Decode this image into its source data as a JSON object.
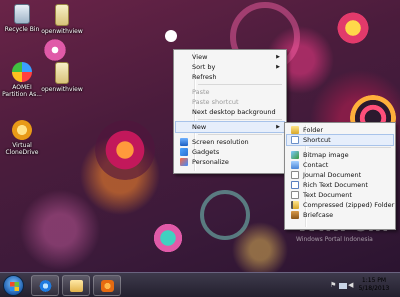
{
  "desktop": {
    "icons": [
      {
        "label": "Recycle Bin",
        "icon": "recycle-bin-icon"
      },
      {
        "label": "openwithview",
        "icon": "folder-icon"
      },
      {
        "label": "AOMEI Partition As...",
        "icon": "aomei-icon"
      },
      {
        "label": "openwithview",
        "icon": "folder-icon"
      },
      {
        "label": "Virtual CloneDrive",
        "icon": "clonedrive-icon"
      }
    ]
  },
  "context_menu": {
    "items": [
      {
        "label": "View",
        "submenu": true
      },
      {
        "label": "Sort by",
        "submenu": true
      },
      {
        "label": "Refresh"
      },
      {
        "label": "Paste",
        "disabled": true
      },
      {
        "label": "Paste shortcut",
        "disabled": true
      },
      {
        "label": "Next desktop background"
      },
      {
        "label": "New",
        "submenu": true
      },
      {
        "label": "Screen resolution"
      },
      {
        "label": "Gadgets"
      },
      {
        "label": "Personalize"
      }
    ]
  },
  "new_submenu": {
    "items": [
      {
        "label": "Folder",
        "icon": "folder-icon"
      },
      {
        "label": "Shortcut",
        "icon": "shortcut-icon"
      },
      {
        "label": "Bitmap image",
        "icon": "bitmap-icon"
      },
      {
        "label": "Contact",
        "icon": "contact-icon"
      },
      {
        "label": "Journal Document",
        "icon": "journal-icon"
      },
      {
        "label": "Rich Text Document",
        "icon": "rtf-icon"
      },
      {
        "label": "Text Document",
        "icon": "text-document-icon"
      },
      {
        "label": "Compressed (zipped) Folder",
        "icon": "zip-folder-icon"
      },
      {
        "label": "Briefcase",
        "icon": "briefcase-icon"
      }
    ]
  },
  "watermark": {
    "brand": "WinPoin",
    "tagline": "Windows Portal Indonesia"
  },
  "taskbar": {
    "pinned": [
      "internet-explorer-icon",
      "windows-explorer-icon",
      "media-player-icon"
    ],
    "tray_icons": [
      "flag-icon",
      "network-icon",
      "volume-icon"
    ],
    "time": "1:15 PM",
    "date": "5/18/2013"
  },
  "colors": {
    "highlight": "#e6eefb",
    "menu_bg": "#f5f5f5",
    "taskbar": "#2b2838"
  }
}
